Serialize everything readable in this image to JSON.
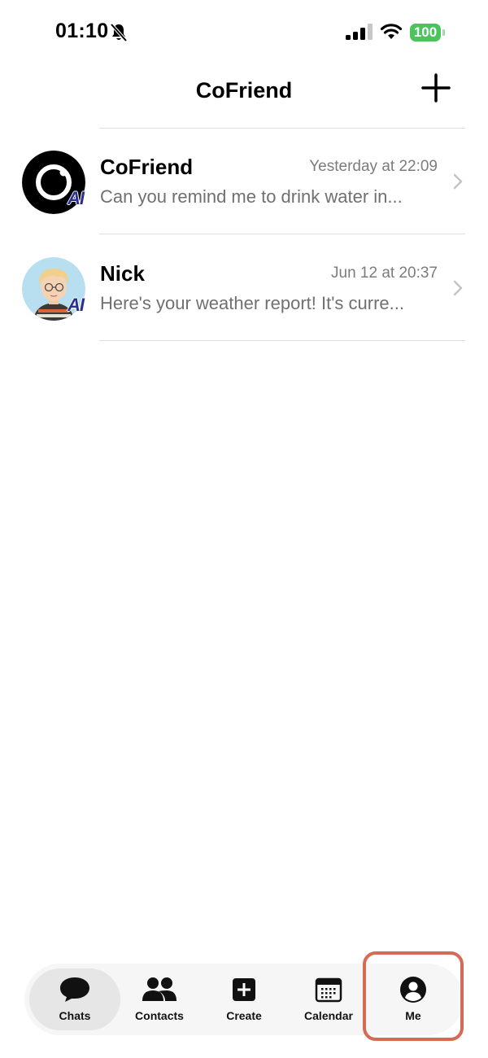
{
  "status_bar": {
    "time": "01:10",
    "battery": "100"
  },
  "header": {
    "title": "CoFriend"
  },
  "chats": [
    {
      "name": "CoFriend",
      "time": "Yesterday at 22:09",
      "preview": "Can you remind me to drink water in...",
      "badge": "AI"
    },
    {
      "name": "Nick",
      "time": "Jun 12 at 20:37",
      "preview": "Here's your weather report! It's curre...",
      "badge": "AI"
    }
  ],
  "tabs": [
    {
      "label": "Chats",
      "icon": "chat-bubble-icon"
    },
    {
      "label": "Contacts",
      "icon": "contacts-icon"
    },
    {
      "label": "Create",
      "icon": "create-plus-icon"
    },
    {
      "label": "Calendar",
      "icon": "calendar-icon"
    },
    {
      "label": "Me",
      "icon": "person-circle-icon"
    }
  ],
  "colors": {
    "battery": "#4cc35d",
    "highlight_border": "#d56b56",
    "active_tab_bg": "#e6e6e6",
    "secondary_text": "#707070"
  }
}
